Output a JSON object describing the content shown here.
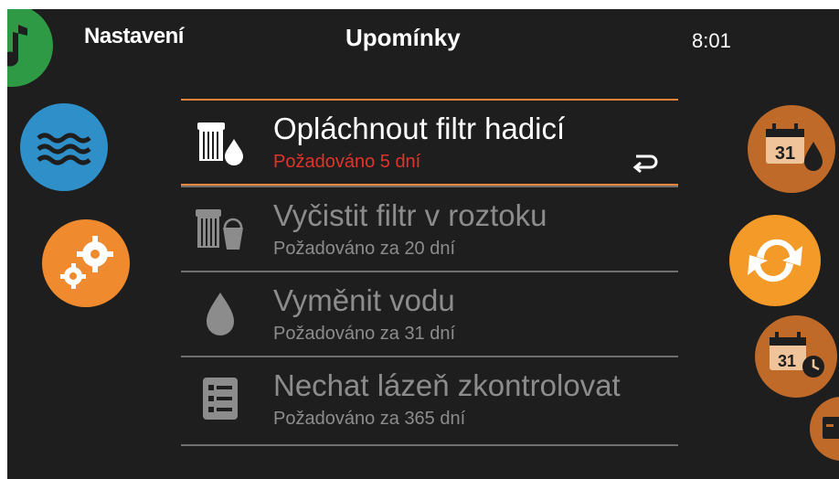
{
  "header": {
    "back_label": "Nastavení",
    "title": "Upomínky",
    "time": "8:01"
  },
  "reminders": [
    {
      "title": "Opláchnout filtr hadicí",
      "subtitle": "Požadováno 5 dní",
      "icon": "filter-drop-icon",
      "active": true
    },
    {
      "title": "Vyčistit filtr v roztoku",
      "subtitle": "Požadováno za 20 dní",
      "icon": "filter-bucket-icon",
      "active": false
    },
    {
      "title": "Vyměnit vodu",
      "subtitle": "Požadováno za 31 dní",
      "icon": "water-drop-icon",
      "active": false
    },
    {
      "title": "Nechat lázeň zkontrolovat",
      "subtitle": "Požadováno za 365 dní",
      "icon": "checklist-icon",
      "active": false
    }
  ],
  "left_nav": [
    "music-icon",
    "pool-water-icon",
    "settings-gears-icon"
  ],
  "right_nav": [
    "calendar-drop-icon",
    "refresh-icon",
    "calendar-clock-icon",
    "calendar-icon"
  ],
  "colors": {
    "background": "#1e1e1e",
    "accent": "#e9843a",
    "alert": "#e0342a",
    "text_dim": "#8c8c8c"
  },
  "calendar_day": "31"
}
